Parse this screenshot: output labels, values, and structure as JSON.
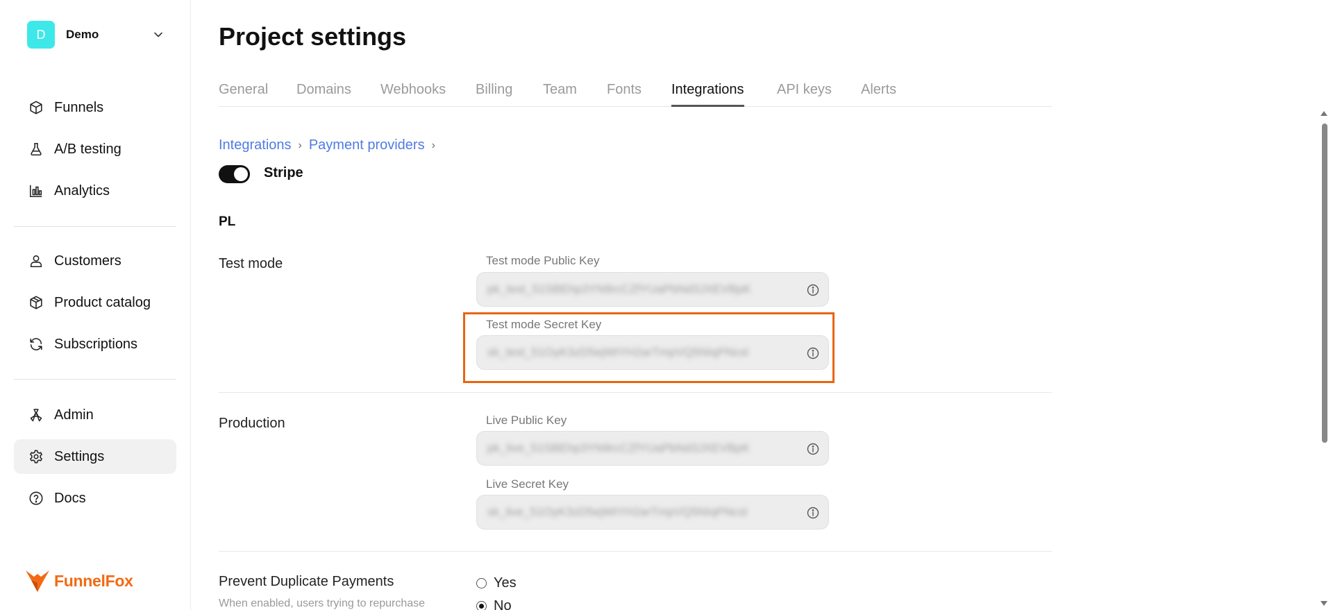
{
  "workspace": {
    "initial": "D",
    "name": "Demo"
  },
  "sidebar": {
    "items": [
      {
        "label": "Funnels",
        "icon": "cube-icon"
      },
      {
        "label": "A/B testing",
        "icon": "flask-icon"
      },
      {
        "label": "Analytics",
        "icon": "bar-chart-icon"
      },
      {
        "label": "Customers",
        "icon": "user-icon"
      },
      {
        "label": "Product catalog",
        "icon": "box-icon"
      },
      {
        "label": "Subscriptions",
        "icon": "refresh-icon"
      },
      {
        "label": "Admin",
        "icon": "admin-icon"
      },
      {
        "label": "Settings",
        "icon": "gear-icon",
        "active": true
      },
      {
        "label": "Docs",
        "icon": "help-circle-icon"
      }
    ]
  },
  "brand": {
    "name": "FunnelFox",
    "color": "#f26a13"
  },
  "page": {
    "title": "Project settings",
    "tabs": [
      "General",
      "Domains",
      "Webhooks",
      "Billing",
      "Team",
      "Fonts",
      "Integrations",
      "API keys",
      "Alerts"
    ],
    "active_tab": "Integrations"
  },
  "breadcrumb": [
    "Integrations",
    "Payment providers"
  ],
  "provider": {
    "name": "Stripe",
    "enabled": true
  },
  "section": "PL",
  "test_mode": {
    "label": "Test mode",
    "public_key_label": "Test mode Public Key",
    "public_key_value": "pk_test_51SBEhp3YN9rcCZfYUaPbNd3JXEVBpK",
    "secret_key_label": "Test mode Secret Key",
    "secret_key_value": "sk_test_51OyK3zD5ejWtYH2arTmpVQ5NIqPNcsl"
  },
  "production": {
    "label": "Production",
    "public_key_label": "Live Public Key",
    "public_key_value": "pk_live_51SBEhp3YN9rcCZfYUaPbNd3JXEVBpK",
    "secret_key_label": "Live Secret Key",
    "secret_key_value": "sk_live_51OyK3zD5ejWtYH2arTmpVQ5NIqPNcsl"
  },
  "duplicate": {
    "label": "Prevent Duplicate Payments",
    "help": "When enabled, users trying to repurchase",
    "options": [
      "Yes",
      "No"
    ],
    "selected": "No"
  },
  "colors": {
    "highlight": "#e8650f",
    "link": "#4f7be0"
  }
}
